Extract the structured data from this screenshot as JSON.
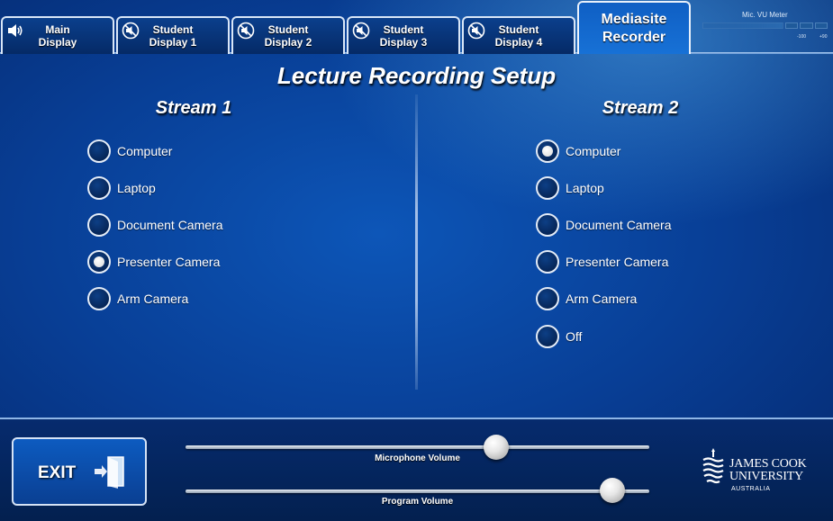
{
  "tabs": [
    {
      "label": "Main\nDisplay",
      "icon": "speaker-icon",
      "active": false
    },
    {
      "label": "Student\nDisplay 1",
      "icon": "speaker-muted-icon",
      "active": false
    },
    {
      "label": "Student\nDisplay 2",
      "icon": "speaker-muted-icon",
      "active": false
    },
    {
      "label": "Student\nDisplay 3",
      "icon": "speaker-muted-icon",
      "active": false
    },
    {
      "label": "Student\nDisplay 4",
      "icon": "speaker-muted-icon",
      "active": false
    },
    {
      "label": "Mediasite\nRecorder",
      "icon": "",
      "active": true
    }
  ],
  "vu_meter": {
    "label": "Mic. VU Meter",
    "scale_left": "-100",
    "scale_right": "+90"
  },
  "title": "Lecture Recording Setup",
  "stream1": {
    "title": "Stream 1",
    "options": [
      {
        "label": "Computer",
        "selected": false
      },
      {
        "label": "Laptop",
        "selected": false
      },
      {
        "label": "Document Camera",
        "selected": false
      },
      {
        "label": "Presenter Camera",
        "selected": true
      },
      {
        "label": "Arm Camera",
        "selected": false
      }
    ]
  },
  "stream2": {
    "title": "Stream 2",
    "options": [
      {
        "label": "Computer",
        "selected": true
      },
      {
        "label": "Laptop",
        "selected": false
      },
      {
        "label": "Document Camera",
        "selected": false
      },
      {
        "label": "Presenter Camera",
        "selected": false
      },
      {
        "label": "Arm Camera",
        "selected": false
      },
      {
        "label": "Off",
        "selected": false
      }
    ]
  },
  "exit": {
    "label": "EXIT",
    "icon": "exit-door-icon"
  },
  "sliders": [
    {
      "label": "Microphone Volume",
      "level": 0.67
    },
    {
      "label": "Program Volume",
      "level": 0.92
    }
  ],
  "logo": {
    "line1": "JAMES COOK",
    "line2": "UNIVERSITY",
    "line3": "AUSTRALIA"
  },
  "colors": {
    "background": "#0a4aa6",
    "tab_border": "#d9e6f7",
    "radio_fill": "#031b45"
  }
}
